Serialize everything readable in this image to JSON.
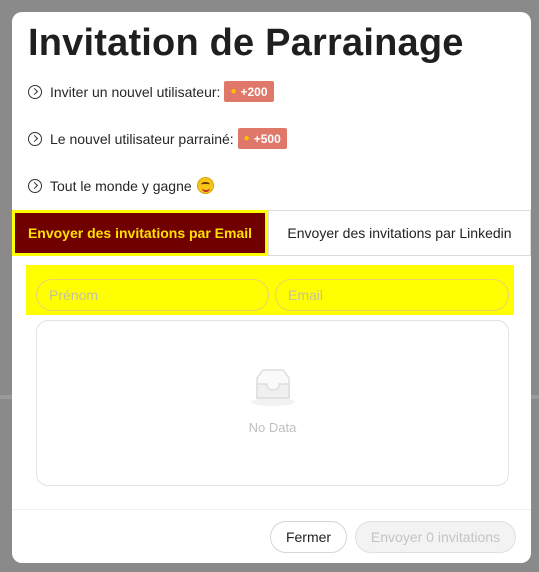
{
  "modal": {
    "title": "Invitation de Parrainage",
    "perks": [
      {
        "text": "Inviter un nouvel utilisateur:",
        "badge": "+200",
        "icon": "chevron-right-circle-icon"
      },
      {
        "text": "Le nouvel utilisateur parrainé:",
        "badge": "+500",
        "icon": "chevron-right-circle-icon"
      },
      {
        "text": "Tout le monde y gagne",
        "emoji": "yum-face-emoji"
      }
    ],
    "badge_color": "#e0786a"
  },
  "tabs": [
    {
      "label": "Envoyer des invitations par Email",
      "active": true
    },
    {
      "label": "Envoyer des invitations par Linkedin",
      "active": false
    }
  ],
  "form": {
    "first_name_placeholder": "Prénom",
    "email_placeholder": "Email"
  },
  "empty_state": {
    "text": "No Data",
    "icon": "inbox-icon"
  },
  "footer": {
    "close_label": "Fermer",
    "send_label": "Envoyer 0 invitations"
  },
  "colors": {
    "accent_bg": "#700000",
    "accent_text": "#ffe100",
    "highlight": "#ffff00"
  }
}
